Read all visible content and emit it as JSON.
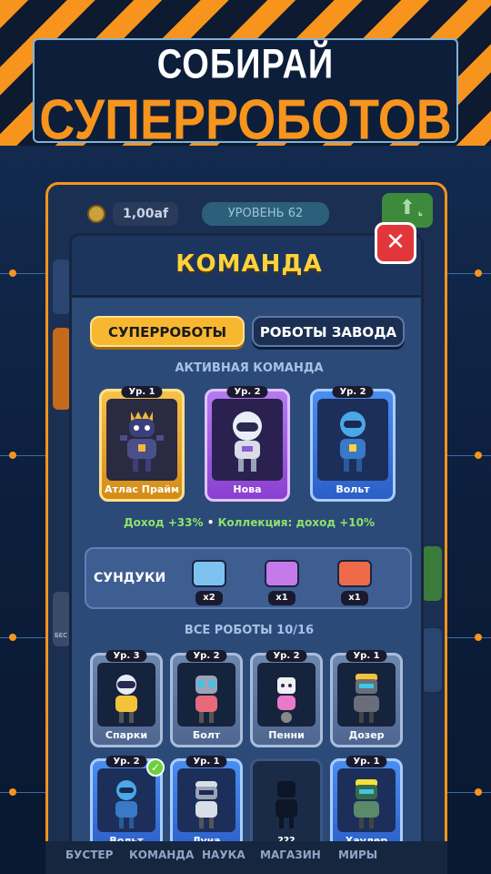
{
  "banner": {
    "line1": "СОБИРАЙ",
    "line2": "СУПЕРРОБОТОВ"
  },
  "hud": {
    "money": "1,00af",
    "level": "УРОВЕНЬ 62",
    "upgrade_fragment": "ь"
  },
  "modal": {
    "title": "КОМАНДА",
    "tabs": [
      {
        "label": "СУПЕРРОБОТЫ",
        "active": true
      },
      {
        "label": "РОБОТЫ ЗАВОДА",
        "active": false
      }
    ],
    "active_team_label": "АКТИВНАЯ КОМАНДА",
    "active_team": [
      {
        "level": "Ур. 1",
        "name": "Атлас Прайм",
        "rarity": "gold"
      },
      {
        "level": "Ур. 2",
        "name": "Нова",
        "rarity": "purple"
      },
      {
        "level": "Ур. 2",
        "name": "Вольт",
        "rarity": "blue"
      }
    ],
    "bonus_income": "Доход +33%",
    "bonus_sep": "•",
    "bonus_collection": "Коллекция: доход +10%",
    "chests_label": "СУНДУКИ",
    "chests": [
      {
        "color": "blue",
        "count": "x2"
      },
      {
        "color": "purple",
        "count": "x1"
      },
      {
        "color": "red",
        "count": "x1"
      }
    ],
    "all_robots_label": "ВСЕ РОБОТЫ 10/16",
    "all_robots": [
      {
        "level": "Ур. 3",
        "name": "Спарки",
        "rarity": "grey"
      },
      {
        "level": "Ур. 2",
        "name": "Болт",
        "rarity": "grey"
      },
      {
        "level": "Ур. 2",
        "name": "Пенни",
        "rarity": "grey"
      },
      {
        "level": "Ур. 1",
        "name": "Дозер",
        "rarity": "grey"
      },
      {
        "level": "Ур. 2",
        "name": "Вольт",
        "rarity": "blue",
        "checked": true
      },
      {
        "level": "Ур. 1",
        "name": "Луна",
        "rarity": "blue"
      },
      {
        "level": "",
        "name": "???",
        "rarity": "dark"
      },
      {
        "level": "Ур. 1",
        "name": "Хаулер",
        "rarity": "blue"
      }
    ]
  },
  "nav": [
    "БУСТЕР",
    "КОМАНДА",
    "НАУКА",
    "МАГАЗИН",
    "МИРЫ"
  ],
  "side_fragments": {
    "left_label": "БЕС"
  },
  "colors": {
    "accent": "#f7941d",
    "title_yellow": "#ffd23c",
    "close_red": "#e2363a"
  }
}
